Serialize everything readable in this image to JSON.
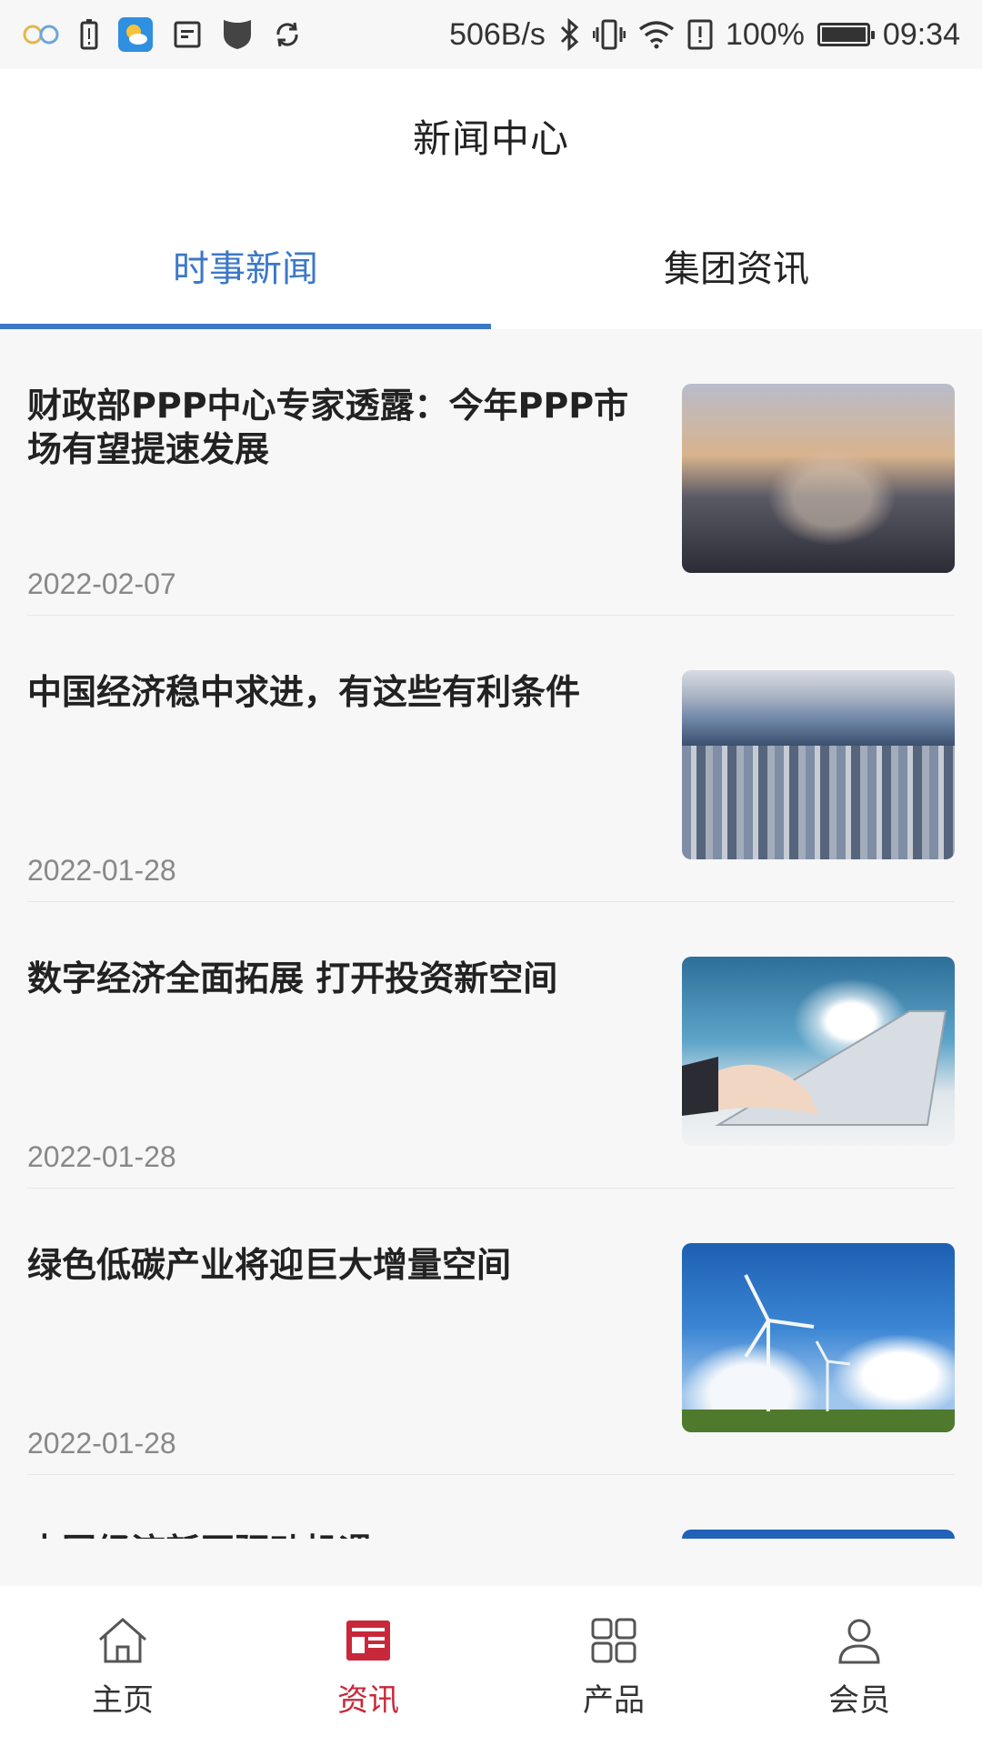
{
  "status_bar": {
    "left_icons": [
      "infinity-icon",
      "battery-alert-icon",
      "weather-app-icon",
      "image-icon",
      "shield-icon",
      "sync-icon"
    ],
    "net_speed": "506B/s",
    "battery_percent": "100%",
    "time": "09:34",
    "battery_level": 1.0
  },
  "header": {
    "title": "新闻中心"
  },
  "tabs": [
    {
      "label": "时事新闻",
      "active": true
    },
    {
      "label": "集团资讯",
      "active": false
    }
  ],
  "news": [
    {
      "title": "财政部PPP中心专家透露：今年PPP市场有望提速发展",
      "date": "2022-02-07",
      "thumb": "handshake-city-image"
    },
    {
      "title": "中国经济稳中求进，有这些有利条件",
      "date": "2022-01-28",
      "thumb": "city-skyline-image"
    },
    {
      "title": "数字经济全面拓展 打开投资新空间",
      "date": "2022-01-28",
      "thumb": "digital-laptop-image"
    },
    {
      "title": "绿色低碳产业将迎巨大增量空间",
      "date": "2022-01-28",
      "thumb": "wind-turbine-image"
    },
    {
      "title": "中国经济新区驱动机遇",
      "date": "",
      "thumb": "blue-tech-image"
    }
  ],
  "bottom_nav": [
    {
      "label": "主页",
      "icon": "home-icon",
      "active": false
    },
    {
      "label": "资讯",
      "icon": "news-icon",
      "active": true
    },
    {
      "label": "产品",
      "icon": "grid-icon",
      "active": false
    },
    {
      "label": "会员",
      "icon": "user-icon",
      "active": false
    }
  ],
  "colors": {
    "accent_blue": "#3c78c8",
    "accent_red": "#c8283a",
    "background": "#f7f7f8"
  }
}
